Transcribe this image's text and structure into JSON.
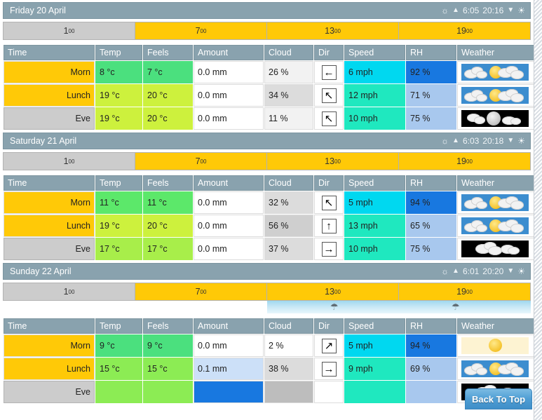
{
  "colors": {
    "header_bg": "#89a2ae",
    "hour_day": "#ffc907",
    "hour_night": "#cccccc",
    "rain_band": "#9fd8ef",
    "back_to_top": "#4f9ed4"
  },
  "columns": [
    "Time",
    "Temp",
    "Feels",
    "Amount",
    "Cloud",
    "Dir",
    "Speed",
    "RH",
    "Weather"
  ],
  "back_to_top_label": "Back To Top",
  "days": [
    {
      "title": "Friday 20 April",
      "sunrise": "6:05",
      "sunset": "20:16",
      "hours": [
        {
          "hh": "1",
          "mm": "00",
          "daylight": false
        },
        {
          "hh": "7",
          "mm": "00",
          "daylight": true
        },
        {
          "hh": "13",
          "mm": "00",
          "daylight": true
        },
        {
          "hh": "19",
          "mm": "00",
          "daylight": true
        }
      ],
      "rain": null,
      "rows": [
        {
          "time": "Morn",
          "time_daylight": true,
          "temp": "8 °c",
          "temp_color": "#4be07e",
          "feels": "7 °c",
          "feels_color": "#4be07e",
          "amount": "0.0 mm",
          "amount_color": "#ffffff",
          "cloud": "26 %",
          "cloud_color": "#f2f2f2",
          "dir": "←",
          "dir_name": "west",
          "speed": "6 mph",
          "speed_color": "#00d8f0",
          "rh": "92 %",
          "rh_color": "#1878e0",
          "weather": "partly-cloudy-day"
        },
        {
          "time": "Lunch",
          "time_daylight": true,
          "temp": "19 °c",
          "temp_color": "#cdf13d",
          "feels": "20 °c",
          "feels_color": "#cdf13d",
          "amount": "0.0 mm",
          "amount_color": "#ffffff",
          "cloud": "34 %",
          "cloud_color": "#dcdcdc",
          "dir": "↖",
          "dir_name": "north-west",
          "speed": "12 mph",
          "speed_color": "#1fe8bf",
          "rh": "71 %",
          "rh_color": "#a8c8ee",
          "weather": "partly-cloudy-day"
        },
        {
          "time": "Eve",
          "time_daylight": false,
          "temp": "19 °c",
          "temp_color": "#cdf13d",
          "feels": "20 °c",
          "feels_color": "#cdf13d",
          "amount": "0.0 mm",
          "amount_color": "#ffffff",
          "cloud": "11 %",
          "cloud_color": "#f2f2f2",
          "dir": "↖",
          "dir_name": "north-west",
          "speed": "10 mph",
          "speed_color": "#1fe8bf",
          "rh": "75 %",
          "rh_color": "#a8c8ee",
          "weather": "partly-cloudy-night"
        }
      ]
    },
    {
      "title": "Saturday 21 April",
      "sunrise": "6:03",
      "sunset": "20:18",
      "hours": [
        {
          "hh": "1",
          "mm": "00",
          "daylight": false
        },
        {
          "hh": "7",
          "mm": "00",
          "daylight": true
        },
        {
          "hh": "13",
          "mm": "00",
          "daylight": true
        },
        {
          "hh": "19",
          "mm": "00",
          "daylight": true
        }
      ],
      "rain": null,
      "rows": [
        {
          "time": "Morn",
          "time_daylight": true,
          "temp": "11 °c",
          "temp_color": "#5ce86a",
          "feels": "11 °c",
          "feels_color": "#5ce86a",
          "amount": "0.0 mm",
          "amount_color": "#ffffff",
          "cloud": "32 %",
          "cloud_color": "#dcdcdc",
          "dir": "↖",
          "dir_name": "north-west",
          "speed": "5 mph",
          "speed_color": "#00d8f0",
          "rh": "94 %",
          "rh_color": "#1878e0",
          "weather": "partly-cloudy-day"
        },
        {
          "time": "Lunch",
          "time_daylight": true,
          "temp": "19 °c",
          "temp_color": "#cdf13d",
          "feels": "20 °c",
          "feels_color": "#cdf13d",
          "amount": "0.0 mm",
          "amount_color": "#ffffff",
          "cloud": "56 %",
          "cloud_color": "#cfcfcf",
          "dir": "↑",
          "dir_name": "north",
          "speed": "13 mph",
          "speed_color": "#1fe8bf",
          "rh": "65 %",
          "rh_color": "#a8c8ee",
          "weather": "partly-cloudy-day"
        },
        {
          "time": "Eve",
          "time_daylight": false,
          "temp": "17 °c",
          "temp_color": "#a8ee4a",
          "feels": "17 °c",
          "feels_color": "#a8ee4a",
          "amount": "0.0 mm",
          "amount_color": "#ffffff",
          "cloud": "37 %",
          "cloud_color": "#dcdcdc",
          "dir": "→",
          "dir_name": "east",
          "speed": "10 mph",
          "speed_color": "#1fe8bf",
          "rh": "75 %",
          "rh_color": "#a8c8ee",
          "weather": "cloudy-night"
        }
      ]
    },
    {
      "title": "Sunday 22 April",
      "sunrise": "6:01",
      "sunset": "20:20",
      "hours": [
        {
          "hh": "1",
          "mm": "00",
          "daylight": false
        },
        {
          "hh": "7",
          "mm": "00",
          "daylight": true
        },
        {
          "hh": "13",
          "mm": "00",
          "daylight": true
        },
        {
          "hh": "19",
          "mm": "00",
          "daylight": true
        }
      ],
      "rain": {
        "start_pct": 50,
        "width_pct": 50,
        "umbrellas_pct": [
          62,
          85
        ]
      },
      "rows": [
        {
          "time": "Morn",
          "time_daylight": true,
          "temp": "9 °c",
          "temp_color": "#4be07e",
          "feels": "9 °c",
          "feels_color": "#4be07e",
          "amount": "0.0 mm",
          "amount_color": "#ffffff",
          "cloud": "2 %",
          "cloud_color": "#ffffff",
          "dir": "↗",
          "dir_name": "north-east",
          "speed": "5 mph",
          "speed_color": "#00d8f0",
          "rh": "94 %",
          "rh_color": "#1878e0",
          "weather": "clear-day"
        },
        {
          "time": "Lunch",
          "time_daylight": true,
          "temp": "15 °c",
          "temp_color": "#8cec54",
          "feels": "15 °c",
          "feels_color": "#8cec54",
          "amount": "0.1 mm",
          "amount_color": "#cce0f8",
          "cloud": "38 %",
          "cloud_color": "#dcdcdc",
          "dir": "→",
          "dir_name": "east",
          "speed": "9 mph",
          "speed_color": "#1fe8bf",
          "rh": "69 %",
          "rh_color": "#a8c8ee",
          "weather": "partly-cloudy-day"
        },
        {
          "time": "Eve",
          "time_daylight": false,
          "temp": "",
          "temp_color": "#8cec54",
          "feels": "",
          "feels_color": "#8cec54",
          "amount": "",
          "amount_color": "#1878e0",
          "cloud": "",
          "cloud_color": "#bdbdbd",
          "dir": "",
          "dir_name": "none",
          "speed": "",
          "speed_color": "#1fe8bf",
          "rh": "",
          "rh_color": "#a8c8ee",
          "weather": "cloudy-night"
        }
      ]
    }
  ]
}
